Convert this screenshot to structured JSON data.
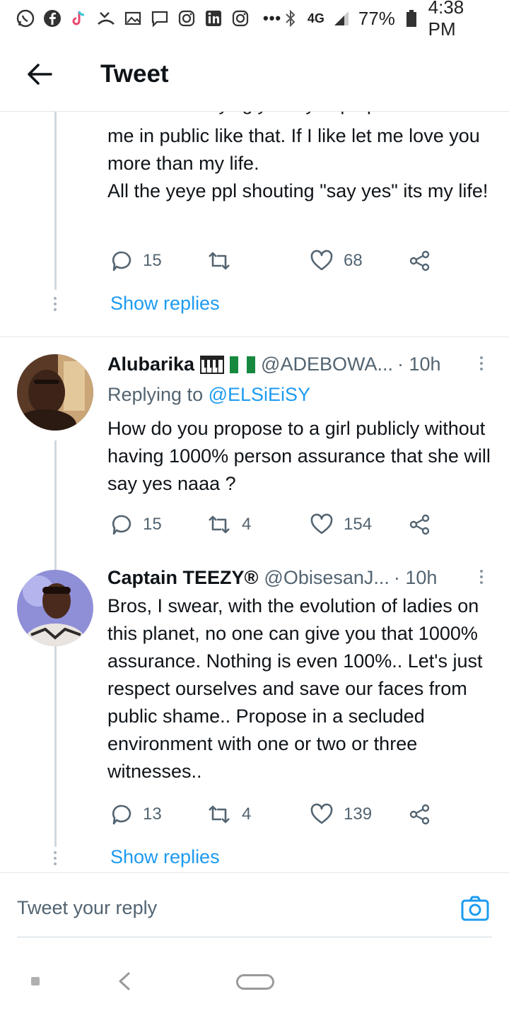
{
  "status_bar": {
    "battery": "77%",
    "time": "4:38 PM",
    "network": "4G",
    "more": "•••"
  },
  "header": {
    "title": "Tweet"
  },
  "top_tweet": {
    "cut_line": "I am never saying yes if you propose to",
    "text": "me in public like that. If I like let me love you more than my life.\nAll the yeye ppl shouting \"say yes\" its my life!",
    "replies": "15",
    "retweets": "",
    "likes": "68",
    "show_replies": "Show replies"
  },
  "tweet2": {
    "name": "Alubarika",
    "name_emoji": "🎹 🇳🇬",
    "handle": "@ADEBOWA...",
    "time": "· 10h",
    "replying_label": "Replying to",
    "replying_to": "@ELSiEiSY",
    "text": "How do you propose to a girl publicly without having 1000% person assurance that she will say yes naaa ?",
    "replies": "15",
    "retweets": "4",
    "likes": "154"
  },
  "tweet3": {
    "name": "Captain TEEZY®",
    "handle": "@ObisesanJ...",
    "time": "· 10h",
    "text": "Bros, I swear, with the evolution of ladies on this planet, no one can give you that 1000% assurance. Nothing is even 100%.. Let's just respect ourselves and save our faces from public shame.. Propose in a secluded environment with one or two or three witnesses..",
    "replies": "13",
    "retweets": "4",
    "likes": "139",
    "show_replies": "Show replies"
  },
  "reply_bar": {
    "placeholder": "Tweet your reply"
  },
  "colors": {
    "accent": "#1d9bf0",
    "secondary_text": "#536471",
    "thread_line": "#cfd9de"
  }
}
